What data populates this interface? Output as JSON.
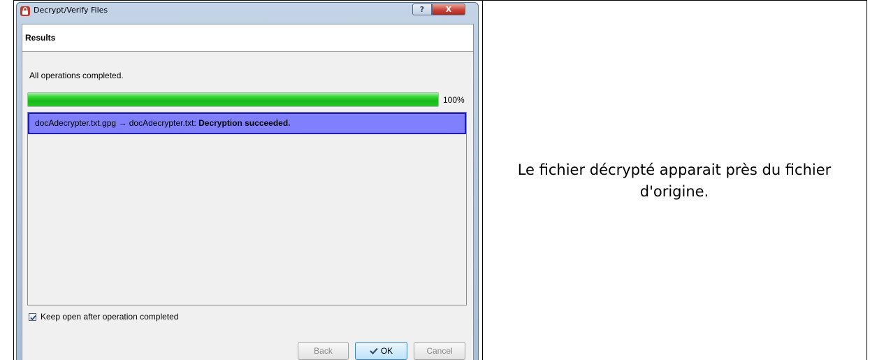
{
  "window": {
    "title": "Decrypt/Verify Files",
    "help_label": "?",
    "close_label": "X"
  },
  "header": {
    "title": "Results"
  },
  "status": {
    "message": "All operations completed.",
    "progress_percent": 100,
    "progress_label": "100%"
  },
  "results": [
    {
      "text": "docAdecrypter.txt.gpg → docAdecrypter.txt: ",
      "status": "Decryption succeeded."
    }
  ],
  "options": {
    "keep_open_label": "Keep open after operation completed",
    "keep_open_checked": true
  },
  "buttons": {
    "back": "Back",
    "ok": "OK",
    "cancel": "Cancel"
  },
  "caption": {
    "text": "Le fichier décrypté apparait près du fichier d'origine."
  },
  "colors": {
    "selection_bg": "#8080ff",
    "selection_border": "#1e1eb4",
    "progress_green": "#17b917",
    "close_red": "#c8443a"
  }
}
